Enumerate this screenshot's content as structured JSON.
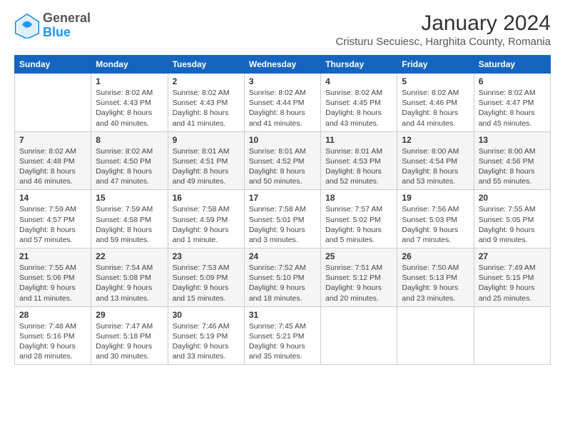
{
  "logo": {
    "general": "General",
    "blue": "Blue"
  },
  "title": "January 2024",
  "subtitle": "Cristuru Secuiesc, Harghita County, Romania",
  "days_of_week": [
    "Sunday",
    "Monday",
    "Tuesday",
    "Wednesday",
    "Thursday",
    "Friday",
    "Saturday"
  ],
  "weeks": [
    [
      {
        "day": "",
        "info": ""
      },
      {
        "day": "1",
        "info": "Sunrise: 8:02 AM\nSunset: 4:43 PM\nDaylight: 8 hours\nand 40 minutes."
      },
      {
        "day": "2",
        "info": "Sunrise: 8:02 AM\nSunset: 4:43 PM\nDaylight: 8 hours\nand 41 minutes."
      },
      {
        "day": "3",
        "info": "Sunrise: 8:02 AM\nSunset: 4:44 PM\nDaylight: 8 hours\nand 41 minutes."
      },
      {
        "day": "4",
        "info": "Sunrise: 8:02 AM\nSunset: 4:45 PM\nDaylight: 8 hours\nand 43 minutes."
      },
      {
        "day": "5",
        "info": "Sunrise: 8:02 AM\nSunset: 4:46 PM\nDaylight: 8 hours\nand 44 minutes."
      },
      {
        "day": "6",
        "info": "Sunrise: 8:02 AM\nSunset: 4:47 PM\nDaylight: 8 hours\nand 45 minutes."
      }
    ],
    [
      {
        "day": "7",
        "info": "Sunrise: 8:02 AM\nSunset: 4:48 PM\nDaylight: 8 hours\nand 46 minutes."
      },
      {
        "day": "8",
        "info": "Sunrise: 8:02 AM\nSunset: 4:50 PM\nDaylight: 8 hours\nand 47 minutes."
      },
      {
        "day": "9",
        "info": "Sunrise: 8:01 AM\nSunset: 4:51 PM\nDaylight: 8 hours\nand 49 minutes."
      },
      {
        "day": "10",
        "info": "Sunrise: 8:01 AM\nSunset: 4:52 PM\nDaylight: 8 hours\nand 50 minutes."
      },
      {
        "day": "11",
        "info": "Sunrise: 8:01 AM\nSunset: 4:53 PM\nDaylight: 8 hours\nand 52 minutes."
      },
      {
        "day": "12",
        "info": "Sunrise: 8:00 AM\nSunset: 4:54 PM\nDaylight: 8 hours\nand 53 minutes."
      },
      {
        "day": "13",
        "info": "Sunrise: 8:00 AM\nSunset: 4:56 PM\nDaylight: 8 hours\nand 55 minutes."
      }
    ],
    [
      {
        "day": "14",
        "info": "Sunrise: 7:59 AM\nSunset: 4:57 PM\nDaylight: 8 hours\nand 57 minutes."
      },
      {
        "day": "15",
        "info": "Sunrise: 7:59 AM\nSunset: 4:58 PM\nDaylight: 8 hours\nand 59 minutes."
      },
      {
        "day": "16",
        "info": "Sunrise: 7:58 AM\nSunset: 4:59 PM\nDaylight: 9 hours\nand 1 minute."
      },
      {
        "day": "17",
        "info": "Sunrise: 7:58 AM\nSunset: 5:01 PM\nDaylight: 9 hours\nand 3 minutes."
      },
      {
        "day": "18",
        "info": "Sunrise: 7:57 AM\nSunset: 5:02 PM\nDaylight: 9 hours\nand 5 minutes."
      },
      {
        "day": "19",
        "info": "Sunrise: 7:56 AM\nSunset: 5:03 PM\nDaylight: 9 hours\nand 7 minutes."
      },
      {
        "day": "20",
        "info": "Sunrise: 7:55 AM\nSunset: 5:05 PM\nDaylight: 9 hours\nand 9 minutes."
      }
    ],
    [
      {
        "day": "21",
        "info": "Sunrise: 7:55 AM\nSunset: 5:06 PM\nDaylight: 9 hours\nand 11 minutes."
      },
      {
        "day": "22",
        "info": "Sunrise: 7:54 AM\nSunset: 5:08 PM\nDaylight: 9 hours\nand 13 minutes."
      },
      {
        "day": "23",
        "info": "Sunrise: 7:53 AM\nSunset: 5:09 PM\nDaylight: 9 hours\nand 15 minutes."
      },
      {
        "day": "24",
        "info": "Sunrise: 7:52 AM\nSunset: 5:10 PM\nDaylight: 9 hours\nand 18 minutes."
      },
      {
        "day": "25",
        "info": "Sunrise: 7:51 AM\nSunset: 5:12 PM\nDaylight: 9 hours\nand 20 minutes."
      },
      {
        "day": "26",
        "info": "Sunrise: 7:50 AM\nSunset: 5:13 PM\nDaylight: 9 hours\nand 23 minutes."
      },
      {
        "day": "27",
        "info": "Sunrise: 7:49 AM\nSunset: 5:15 PM\nDaylight: 9 hours\nand 25 minutes."
      }
    ],
    [
      {
        "day": "28",
        "info": "Sunrise: 7:48 AM\nSunset: 5:16 PM\nDaylight: 9 hours\nand 28 minutes."
      },
      {
        "day": "29",
        "info": "Sunrise: 7:47 AM\nSunset: 5:18 PM\nDaylight: 9 hours\nand 30 minutes."
      },
      {
        "day": "30",
        "info": "Sunrise: 7:46 AM\nSunset: 5:19 PM\nDaylight: 9 hours\nand 33 minutes."
      },
      {
        "day": "31",
        "info": "Sunrise: 7:45 AM\nSunset: 5:21 PM\nDaylight: 9 hours\nand 35 minutes."
      },
      {
        "day": "",
        "info": ""
      },
      {
        "day": "",
        "info": ""
      },
      {
        "day": "",
        "info": ""
      }
    ]
  ]
}
